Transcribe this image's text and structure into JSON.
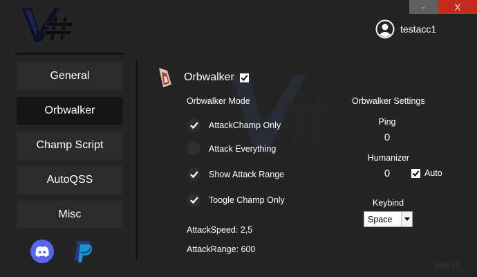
{
  "window": {
    "minimize_label": "-",
    "close_label": "X"
  },
  "user": {
    "name": "testacc1"
  },
  "sidebar": {
    "items": [
      {
        "label": "General",
        "active": false
      },
      {
        "label": "Orbwalker",
        "active": true
      },
      {
        "label": "Champ Script",
        "active": false
      },
      {
        "label": "AutoQSS",
        "active": false
      },
      {
        "label": "Misc",
        "active": false
      }
    ]
  },
  "main": {
    "title": "Orbwalker",
    "title_enabled": true,
    "mode_label": "Orbwalker Mode",
    "options": [
      {
        "label": "AttackChamp Only",
        "checked": true
      },
      {
        "label": "Attack Everything",
        "checked": false
      },
      {
        "label": "Show Attack Range",
        "checked": true
      },
      {
        "label": "Toogle Champ Only",
        "checked": true
      }
    ],
    "attack_speed": "AttackSpeed: 2,5",
    "attack_range": "AttackRange: 600",
    "settings": {
      "title": "Orbwalker Settings",
      "ping_label": "Ping",
      "ping_value": "0",
      "humanizer_label": "Humanizer",
      "humanizer_value": "0",
      "auto_label": "Auto",
      "auto_checked": true,
      "keybind_label": "Keybind",
      "keybind_value": "Space"
    }
  },
  "footer": {
    "version": "load 1.1"
  },
  "colors": {
    "background": "#242424",
    "nav_item": "#2b2b2b",
    "nav_active": "#151515",
    "close_red": "#c42b1c",
    "discord": "#5865f2",
    "paypal_dark": "#253b80",
    "paypal_light": "#179bd7"
  },
  "icons": {
    "logo": "v-hash-logo",
    "user": "user-circle-icon",
    "discord": "discord-icon",
    "paypal": "paypal-icon",
    "champion": "champion-portrait-icon"
  }
}
